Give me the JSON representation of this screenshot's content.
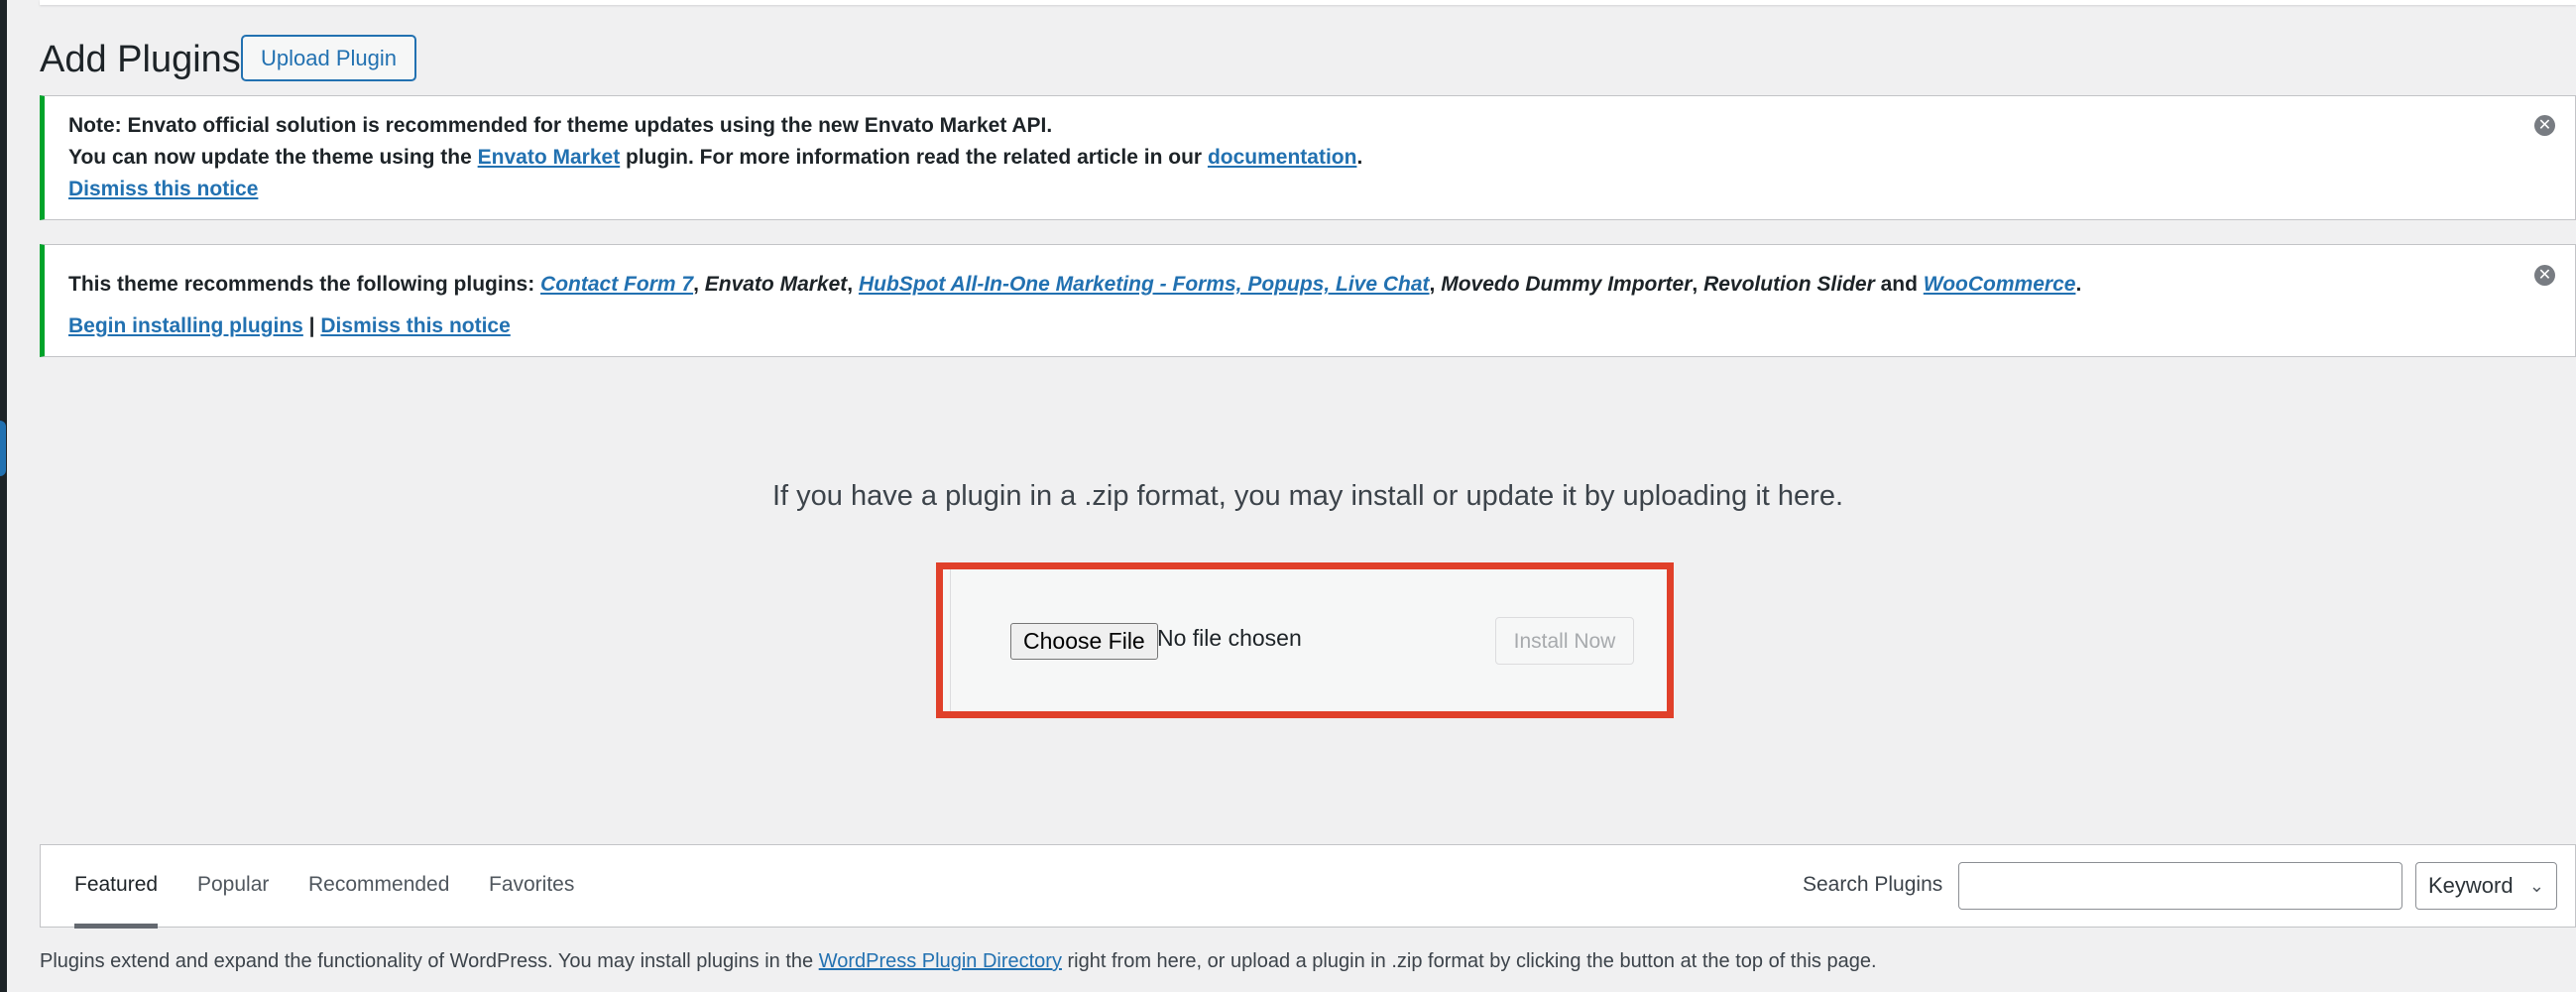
{
  "header": {
    "title": "Add Plugins",
    "upload_button": "Upload Plugin"
  },
  "notice_envato": {
    "line1": "Note: Envato official solution is recommended for theme updates using the new Envato Market API.",
    "line2_prefix": "You can now update the theme using the ",
    "link_envato_market": "Envato Market",
    "line2_middle": " plugin. For more information read the related article in our ",
    "link_documentation": "documentation",
    "line2_suffix": ".",
    "dismiss_link": "Dismiss this notice",
    "dismiss_icon": "close-circle-icon"
  },
  "notice_plugins": {
    "prefix": "This theme recommends the following plugins: ",
    "plugins": [
      {
        "name": "Contact Form 7",
        "linked": true,
        "sep": ", "
      },
      {
        "name": "Envato Market",
        "linked": false,
        "sep": ", "
      },
      {
        "name": "HubSpot All-In-One Marketing - Forms, Popups, Live Chat",
        "linked": true,
        "sep": ", "
      },
      {
        "name": "Movedo Dummy Importer",
        "linked": false,
        "sep": ", "
      },
      {
        "name": "Revolution Slider",
        "linked": false,
        "sep": " and "
      },
      {
        "name": "WooCommerce",
        "linked": true,
        "sep": "."
      }
    ],
    "begin_installing": "Begin installing plugins",
    "separator": " | ",
    "dismiss_link": "Dismiss this notice",
    "dismiss_icon": "close-circle-icon"
  },
  "upload": {
    "hint": "If you have a plugin in a .zip format, you may install or update it by uploading it here.",
    "choose_file": "Choose File",
    "no_file": "No file chosen",
    "install_now": "Install Now",
    "highlight_color": "#e0402a"
  },
  "filter": {
    "tabs": [
      "Featured",
      "Popular",
      "Recommended",
      "Favorites"
    ],
    "current_tab": "Featured",
    "search_label": "Search Plugins",
    "search_value": "",
    "search_type": "Keyword"
  },
  "footer": {
    "prefix": "Plugins extend and expand the functionality of WordPress. You may install plugins in the ",
    "link": "WordPress Plugin Directory",
    "suffix": " right from here, or upload a plugin in .zip format by clicking the button at the top of this page."
  },
  "colors": {
    "accent": "#2271b1",
    "notice_success": "#00a32a",
    "background": "#f0f0f1"
  }
}
